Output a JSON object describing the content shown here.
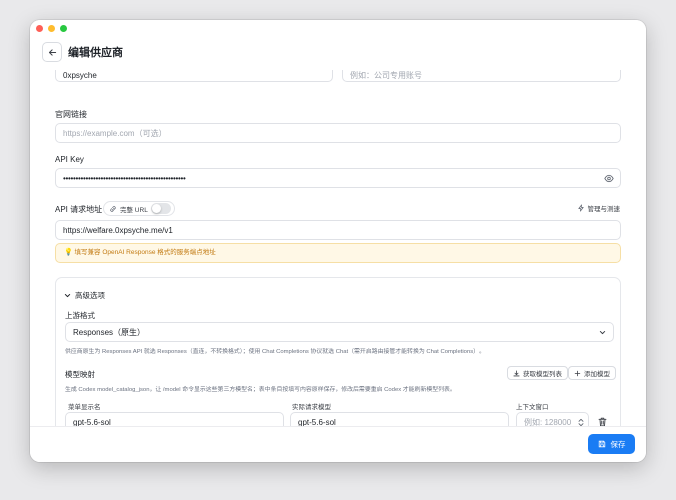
{
  "header": {
    "title": "编辑供应商"
  },
  "top_fields": {
    "name_value": "0xpsyche",
    "remark_placeholder": "例如：公司专用账号"
  },
  "website": {
    "label": "官网链接",
    "placeholder": "https://example.com（可选）"
  },
  "api_key": {
    "label": "API Key",
    "value": "•••••••••••••••••••••••••••••••••••••••••••••••••"
  },
  "endpoint": {
    "label": "API 请求地址",
    "full_url_label": "完整 URL",
    "manage_label": "管理与测速",
    "value": "https://welfare.0xpsyche.me/v1",
    "hint": "填写兼容 OpenAI Response 格式的服务端点地址"
  },
  "advanced": {
    "title": "高级选项",
    "upstream_label": "上游格式",
    "upstream_value": "Responses（原生）",
    "upstream_help": "供应商原生为 Responses API 就选 Responses（直连，不转换格式）；使用 Chat Completions 协议就选 Chat（需开启路由接管才能转换为 Chat Completions）。",
    "mapping_title": "模型映射",
    "fetch_models_button": "获取模型列表",
    "add_model_button": "添加模型",
    "mapping_help": "生成 Codex model_catalog_json，让 /model 命令显示这些第三方模型名；表中条目按填写内容原样保存，修改后需要重启 Codex 才能刷新模型列表。",
    "columns": [
      "菜单显示名",
      "实际请求模型",
      "上下文窗口"
    ],
    "rows": [
      {
        "display": "gpt-5.6-sol",
        "actual": "gpt-5.6-sol",
        "context_placeholder": "例如: 128000"
      }
    ]
  },
  "footer": {
    "save_label": "保存"
  },
  "colors": {
    "accent": "#1a7cf4",
    "warning_bg": "#fff8e6",
    "warning_text": "#c27a12"
  }
}
